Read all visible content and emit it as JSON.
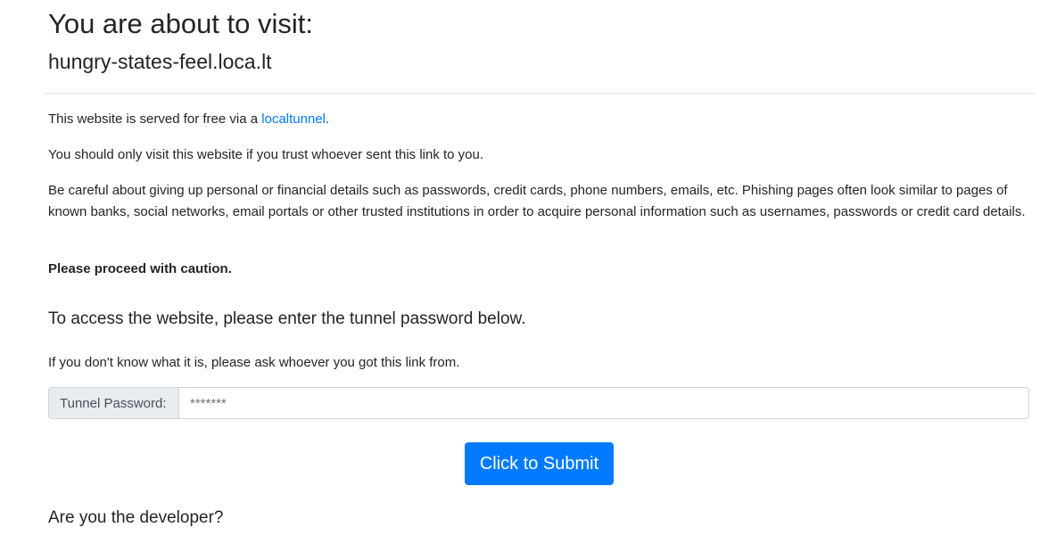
{
  "header": {
    "title": "You are about to visit:",
    "host": "hungry-states-feel.loca.lt"
  },
  "notice": {
    "served_prefix": "This website is served for free via a ",
    "served_link": "localtunnel",
    "served_suffix": ".",
    "trust": "You should only visit this website if you trust whoever sent this link to you.",
    "warning": "Be careful about giving up personal or financial details such as passwords, credit cards, phone numbers, emails, etc. Phishing pages often look similar to pages of known banks, social networks, email portals or other trusted institutions in order to acquire personal information such as usernames, passwords or credit card details.",
    "caution": "Please proceed with caution."
  },
  "access": {
    "heading": "To access the website, please enter the tunnel password below.",
    "help": "If you don't know what it is, please ask whoever you got this link from.",
    "password_label": "Tunnel Password:",
    "password_placeholder": "*******",
    "submit_label": "Click to Submit"
  },
  "developer": {
    "heading": "Are you the developer?"
  },
  "colors": {
    "accent": "#007bff",
    "text": "#212529",
    "prepend_bg": "#e9ecef",
    "border": "#ced4da"
  }
}
